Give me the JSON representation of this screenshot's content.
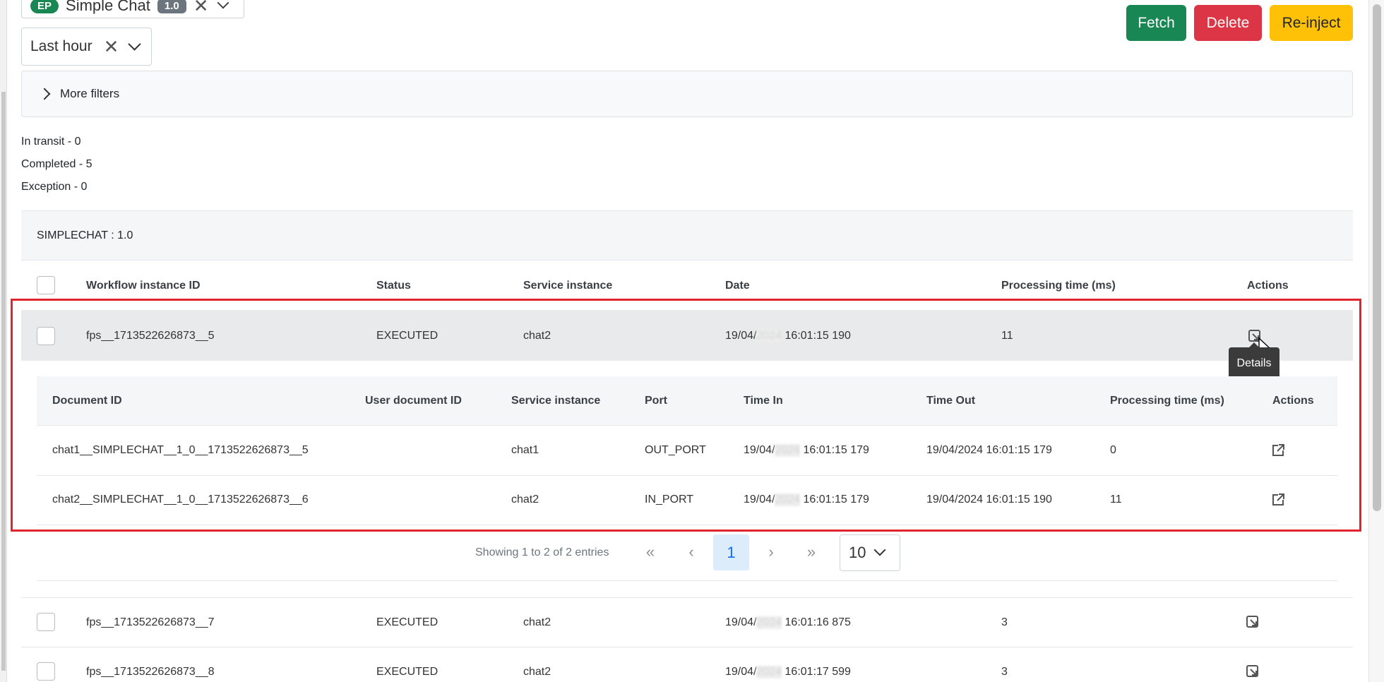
{
  "filters": {
    "workflow_badge": "EP",
    "workflow_name": "Simple Chat",
    "workflow_version": "1.0",
    "time_range": "Last hour",
    "more_filters": "More filters"
  },
  "actions": {
    "fetch": "Fetch",
    "delete": "Delete",
    "reinject": "Re-inject"
  },
  "stats": {
    "in_transit": "In transit - 0",
    "completed": "Completed - 5",
    "exception": "Exception - 0"
  },
  "panel": {
    "title": "SIMPLECHAT : 1.0",
    "columns": [
      "Workflow instance ID",
      "Status",
      "Service instance",
      "Date",
      "Processing time (ms)",
      "Actions"
    ],
    "rows": [
      {
        "id": "fps__1713522626873__5",
        "status": "EXECUTED",
        "service": "chat2",
        "date_pre": "19/04/",
        "date_year": "2024",
        "date_post": " 16:01:15 190",
        "time": "11"
      },
      {
        "id": "fps__1713522626873__7",
        "status": "EXECUTED",
        "service": "chat2",
        "date_pre": "19/04/",
        "date_year": "2024",
        "date_post": " 16:01:16 875",
        "time": "3"
      },
      {
        "id": "fps__1713522626873__8",
        "status": "EXECUTED",
        "service": "chat2",
        "date_pre": "19/04/",
        "date_year": "2024",
        "date_post": " 16:01:17 599",
        "time": "3"
      }
    ]
  },
  "tooltip": "Details",
  "documents": {
    "columns": [
      "Document ID",
      "User document ID",
      "Service instance",
      "Port",
      "Time In",
      "Time Out",
      "Processing time (ms)",
      "Actions"
    ],
    "rows": [
      {
        "doc_id": "chat1__SIMPLECHAT__1_0__1713522626873__5",
        "user_doc_id": "",
        "service": "chat1",
        "port": "OUT_PORT",
        "time_in_pre": "19/04/",
        "time_in_year": "2024",
        "time_in_post": " 16:01:15 179",
        "time_out": "19/04/2024 16:01:15 179",
        "time": "0"
      },
      {
        "doc_id": "chat2__SIMPLECHAT__1_0__1713522626873__6",
        "user_doc_id": "",
        "service": "chat2",
        "port": "IN_PORT",
        "time_in_pre": "19/04/",
        "time_in_year": "2024",
        "time_in_post": " 16:01:15 179",
        "time_out": "19/04/2024 16:01:15 190",
        "time": "11"
      }
    ]
  },
  "pagination": {
    "summary": "Showing 1 to 2 of 2 entries",
    "first": "«",
    "prev": "‹",
    "current": "1",
    "next": "›",
    "last": "»",
    "page_size": "10"
  },
  "icons": {
    "details": "details-icon",
    "open": "external-link-icon"
  },
  "colors": {
    "fetch": "#198754",
    "delete": "#dc3545",
    "reinject": "#ffc107",
    "highlight": "#e0242c"
  }
}
